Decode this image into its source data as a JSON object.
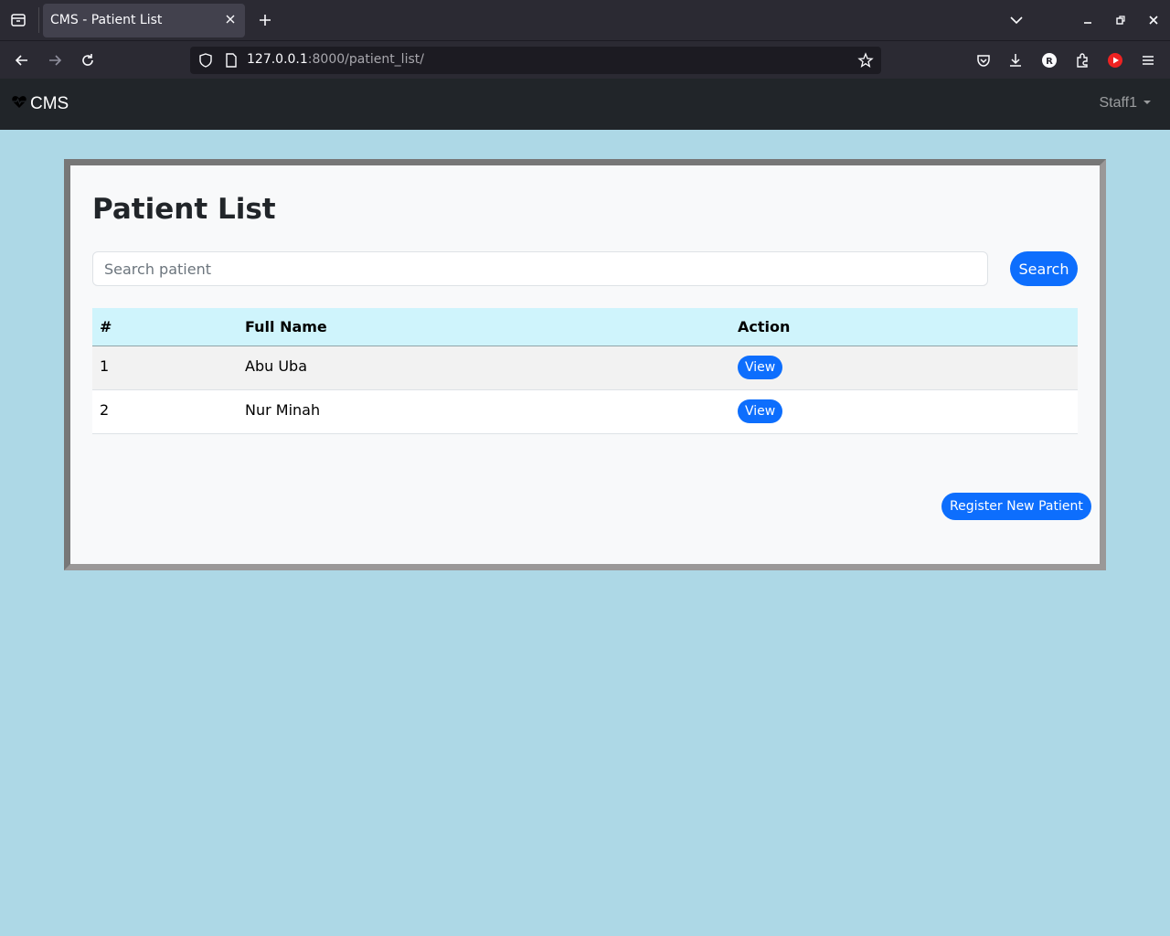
{
  "browser": {
    "tab_title": "CMS - Patient List",
    "url_host": "127.0.0.1",
    "url_rest": ":8000/patient_list/"
  },
  "app": {
    "brand": "CMS",
    "user": "Staff1"
  },
  "page": {
    "title": "Patient List",
    "search_placeholder": "Search patient",
    "search_value": "",
    "search_button": "Search",
    "register_button": "Register New Patient"
  },
  "table": {
    "headers": [
      "#",
      "Full Name",
      "Action"
    ],
    "rows": [
      {
        "num": "1",
        "name": "Abu Uba",
        "action": "View"
      },
      {
        "num": "2",
        "name": "Nur Minah",
        "action": "View"
      }
    ]
  },
  "colors": {
    "page_bg": "#add8e6",
    "primary": "#0d6efd",
    "navbar": "#212529",
    "table_header": "#cff4fc"
  }
}
